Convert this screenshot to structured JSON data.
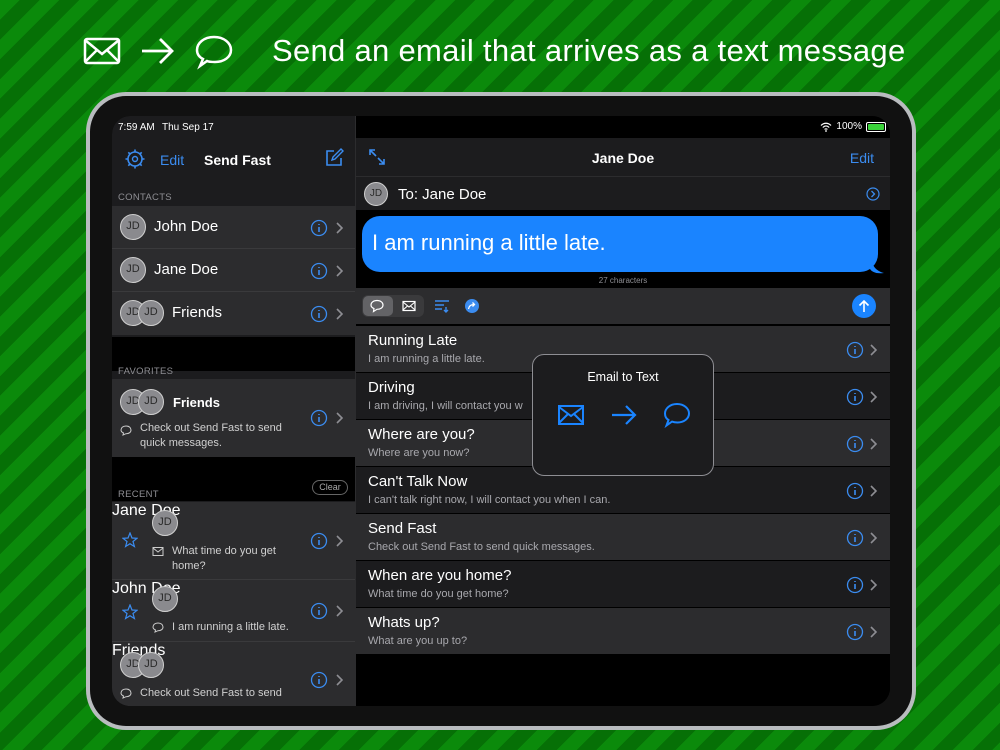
{
  "banner": {
    "text": "Send an email that arrives as a text message",
    "icons": [
      "envelope-icon",
      "arrow-right-icon",
      "chat-bubble-icon"
    ]
  },
  "status_bar": {
    "time": "7:59 AM",
    "date": "Thu Sep 17",
    "battery": "100%"
  },
  "sidebar": {
    "edit_label": "Edit",
    "title": "Send Fast",
    "contacts_header": "CONTACTS",
    "contacts": [
      {
        "initials": "JD",
        "name": "John Doe"
      },
      {
        "initials": "JD",
        "name": "Jane Doe"
      },
      {
        "initials": "JD",
        "name": "Friends"
      }
    ],
    "favorites_header": "FAVORITES",
    "favorite": {
      "initials": "JD",
      "name": "Friends",
      "message": "Check out Send Fast to send quick messages."
    },
    "recent_header": "RECENT",
    "clear_label": "Clear",
    "recent": [
      {
        "initials": "JD",
        "name": "Jane Doe",
        "message": "What time do you get home?",
        "type": "email"
      },
      {
        "initials": "JD",
        "name": "John Doe",
        "message": "I am running a little late.",
        "type": "text"
      },
      {
        "initials": "JD",
        "name": "Friends",
        "message": "Check out Send Fast to send",
        "type": "text"
      }
    ]
  },
  "main": {
    "title": "Jane Doe",
    "edit_label": "Edit",
    "to": {
      "initials": "JD",
      "label": "To: Jane Doe"
    },
    "message": "I am running a little late.",
    "char_count": "27 characters",
    "accent": "#1a84ff",
    "templates": [
      {
        "title": "Running Late",
        "body": "I am running a little late."
      },
      {
        "title": "Driving",
        "body": "I am driving, I will contact you w"
      },
      {
        "title": "Where are you?",
        "body": "Where are you now?"
      },
      {
        "title": "Can't Talk Now",
        "body": "I can't talk right now, I will contact you when I can."
      },
      {
        "title": "Send Fast",
        "body": "Check out Send Fast to send quick messages."
      },
      {
        "title": "When are you home?",
        "body": "What time do you get home?"
      },
      {
        "title": "Whats up?",
        "body": "What are you up to?"
      }
    ]
  },
  "popover": {
    "title": "Email to Text"
  }
}
